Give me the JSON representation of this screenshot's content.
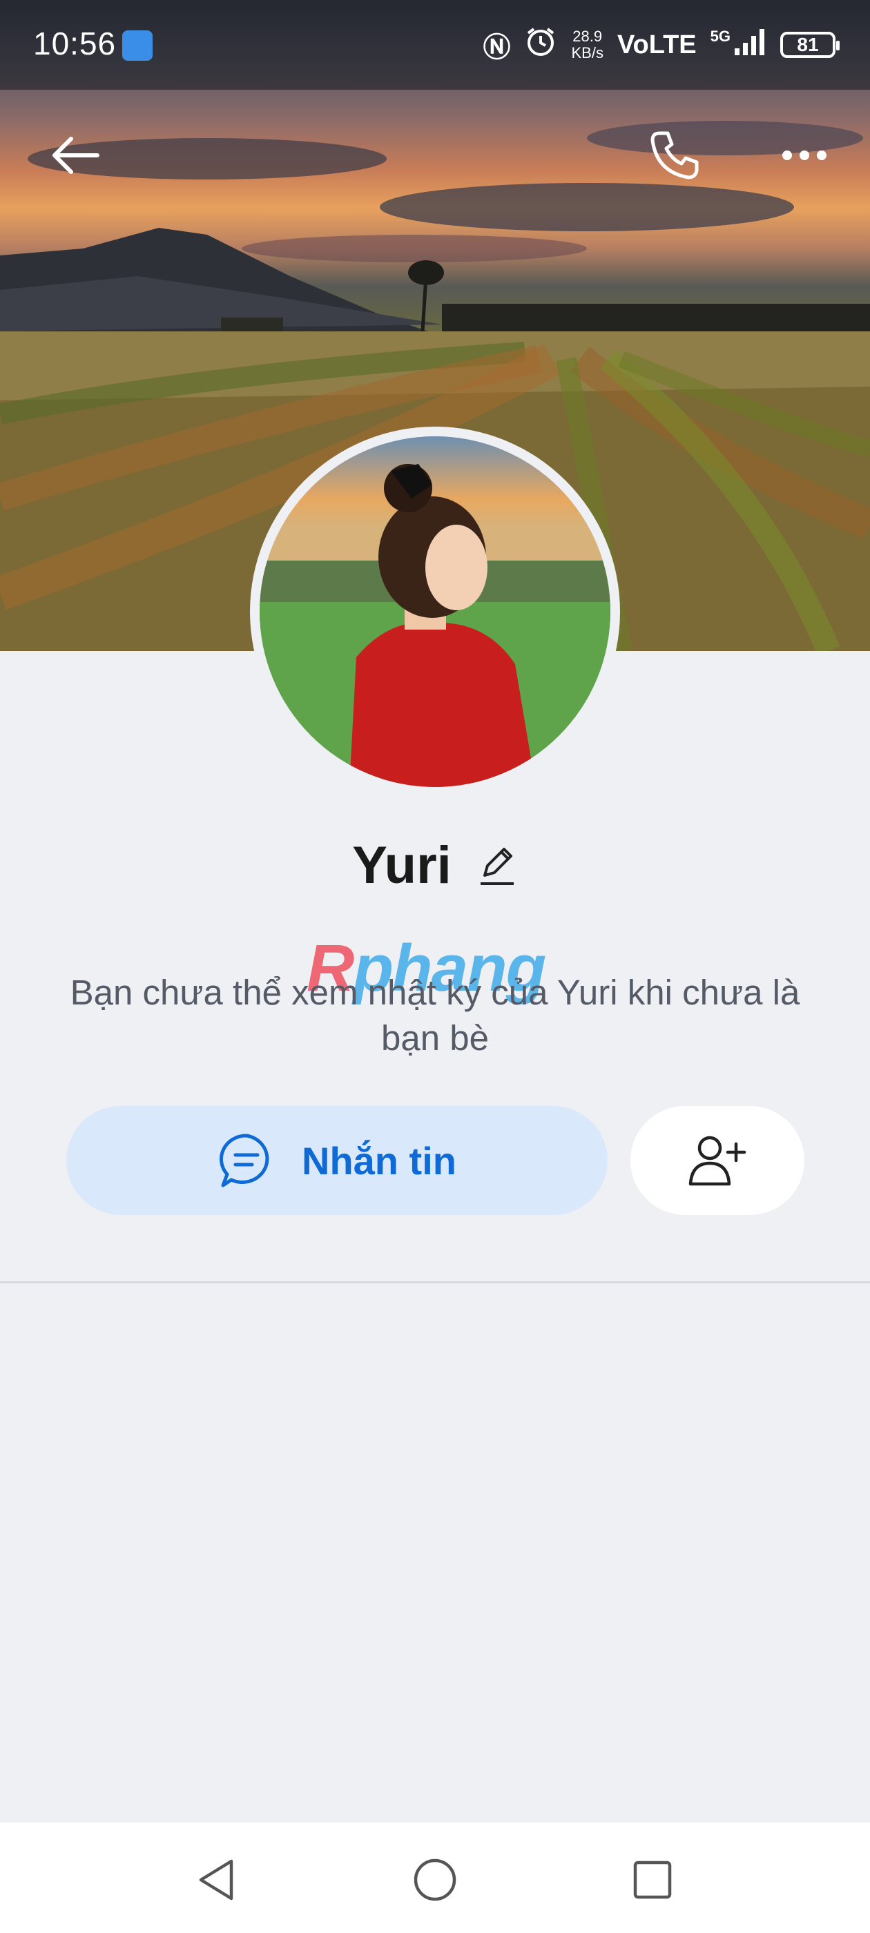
{
  "status_bar": {
    "time": "10:56",
    "speed_value": "28.9",
    "speed_unit": "KB/s",
    "network": "VoLTE",
    "network_gen": "5G",
    "battery": "81"
  },
  "profile": {
    "name": "Yuri",
    "notice": "Bạn chưa thể xem nhật ký của Yuri khi chưa là bạn bè"
  },
  "watermark": {
    "part1": "R",
    "part2": "phang"
  },
  "actions": {
    "message_label": "Nhắn tin"
  },
  "colors": {
    "accent": "#0f6ad6",
    "message_button_bg": "#d9e9fb",
    "background": "#eff0f4"
  },
  "icons": {
    "back": "back-arrow-icon",
    "call": "phone-icon",
    "more": "more-icon",
    "edit": "pencil-icon",
    "message": "chat-bubble-icon",
    "add_friend": "add-user-icon",
    "nav_back": "triangle-back-icon",
    "nav_home": "circle-home-icon",
    "nav_recents": "square-recents-icon"
  }
}
